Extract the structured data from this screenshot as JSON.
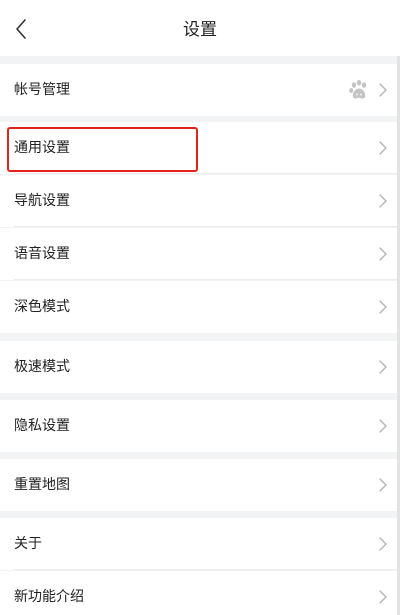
{
  "header": {
    "title": "设置"
  },
  "sections": [
    {
      "items": [
        {
          "key": "account",
          "label": "帐号管理",
          "icon": "baidu-paw-icon"
        }
      ]
    },
    {
      "items": [
        {
          "key": "general",
          "label": "通用设置",
          "highlighted": true
        },
        {
          "key": "navigation",
          "label": "导航设置"
        },
        {
          "key": "voice",
          "label": "语音设置"
        },
        {
          "key": "dark",
          "label": "深色模式"
        }
      ]
    },
    {
      "items": [
        {
          "key": "speed",
          "label": "极速模式"
        }
      ]
    },
    {
      "items": [
        {
          "key": "privacy",
          "label": "隐私设置"
        }
      ]
    },
    {
      "items": [
        {
          "key": "reset",
          "label": "重置地图"
        }
      ]
    },
    {
      "items": [
        {
          "key": "about",
          "label": "关于"
        },
        {
          "key": "new",
          "label": "新功能介绍"
        }
      ]
    }
  ],
  "colors": {
    "highlight": "#e0241c",
    "background": "#f2f3f5",
    "row": "#ffffff"
  }
}
